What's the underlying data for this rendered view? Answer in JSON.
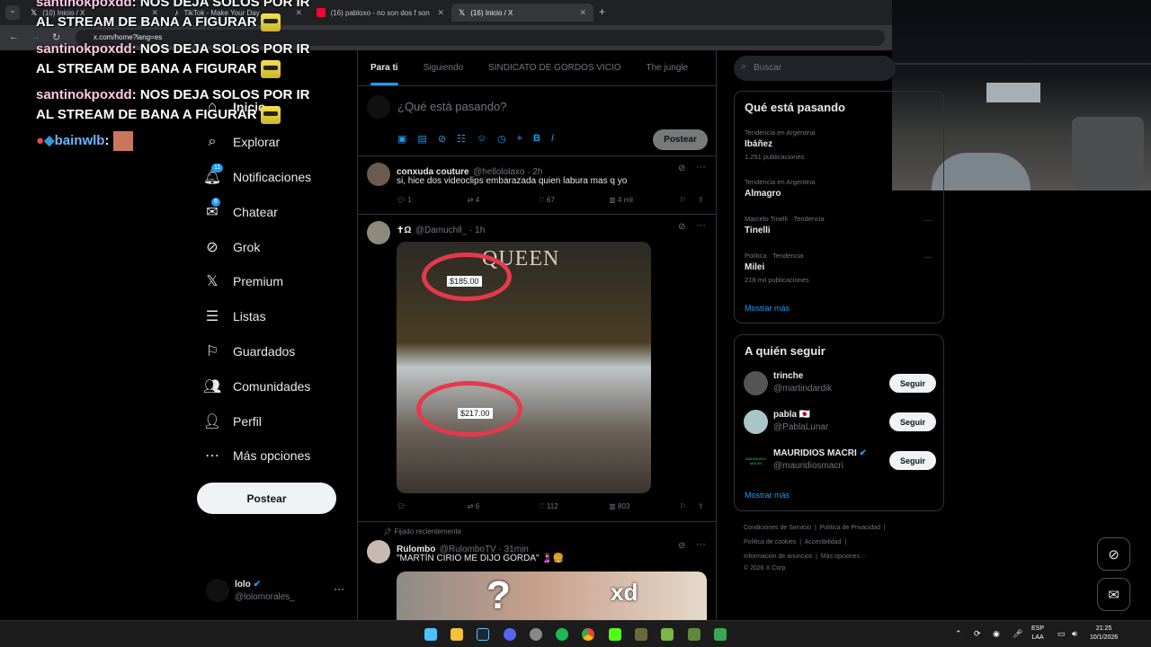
{
  "browser": {
    "tabs": [
      {
        "label": "(10) Inicio / X",
        "icon": "x-logo-icon"
      },
      {
        "label": "TikTok - Make Your Day",
        "icon": "tiktok-icon"
      },
      {
        "label": "(16) pabloxo - no son dos f son",
        "icon": "youtube-icon"
      },
      {
        "label": "(16) Inicio / X",
        "icon": "x-logo-icon"
      }
    ],
    "url": "x.com/home?lang=es"
  },
  "chat_overlay": [
    {
      "user": "santinokpoxdd",
      "message": "NOS DEJA SOLOS POR IR AL STREAM DE BANA A FIGURAR"
    },
    {
      "user": "santinokpoxdd",
      "message": "NOS DEJA SOLOS POR IR AL STREAM DE BANA A FIGURAR"
    },
    {
      "user": "santinokpoxdd",
      "message": "NOS DEJA SOLOS POR IR AL STREAM DE BANA A FIGURAR"
    },
    {
      "user": "bainwlb",
      "message": ""
    }
  ],
  "nav": {
    "items": [
      {
        "label": "Inicio",
        "icon": "home-icon"
      },
      {
        "label": "Explorar",
        "icon": "search-icon"
      },
      {
        "label": "Notificaciones",
        "icon": "bell-icon",
        "badge": "11"
      },
      {
        "label": "Chatear",
        "icon": "mail-icon",
        "badge": "6"
      },
      {
        "label": "Grok",
        "icon": "grok-icon"
      },
      {
        "label": "Premium",
        "icon": "x-logo-icon"
      },
      {
        "label": "Listas",
        "icon": "list-icon"
      },
      {
        "label": "Guardados",
        "icon": "bookmark-icon"
      },
      {
        "label": "Comunidades",
        "icon": "communities-icon"
      },
      {
        "label": "Perfil",
        "icon": "person-icon"
      },
      {
        "label": "Más opciones",
        "icon": "more-circle-icon"
      }
    ],
    "post_button": "Postear",
    "account": {
      "name": "lolo",
      "handle": "@lolomorales_"
    }
  },
  "feed": {
    "tabs": [
      "Para ti",
      "Siguiendo",
      "SINDICATO DE GORDOS VICIO",
      "The jungle"
    ],
    "compose_placeholder": "¿Qué está pasando?",
    "compose_button": "Postear",
    "tweets": [
      {
        "name": "conxuda couture",
        "handle": "@hellololaxo · 2h",
        "text": "si, hice dos videoclips embarazada quien labura mas q yo",
        "replies": "1",
        "reposts": "4",
        "likes": "67",
        "views": "4 mil"
      },
      {
        "name": "✝Ω",
        "handle": "@Damuchll_ · 1h",
        "text": "",
        "image_text": [
          "QUEEN",
          "$185.00",
          "$217.00"
        ],
        "replies": "",
        "reposts": "6",
        "likes": "112",
        "views": "803"
      },
      {
        "pinned_label": "Fijado recientemente",
        "name": "Rulombo",
        "handle": "@RulomboTV · 31min",
        "text": "\"MARTÍN CIRIO ME DIJO GORDA\" 🤰🍔",
        "image_text": [
          "?",
          "xd"
        ]
      }
    ]
  },
  "sidebar": {
    "search_placeholder": "Buscar",
    "trends_title": "Qué está pasando",
    "trends": [
      {
        "category": "Tendencia en Argentina",
        "title": "Ibáñez",
        "count": "1.291 publicaciones"
      },
      {
        "category": "Tendencia en Argentina",
        "title": "Almagro",
        "count": ""
      },
      {
        "category": "Marcelo Tinelli · Tendencia",
        "title": "Tinelli",
        "count": ""
      },
      {
        "category": "Política · Tendencia",
        "title": "Milei",
        "count": "218 mil publicaciones"
      }
    ],
    "trends_more": "Mostrar más",
    "follow_title": "A quién seguir",
    "follow": [
      {
        "name": "trinche",
        "handle": "@martindardik",
        "button": "Seguir"
      },
      {
        "name": "pabla 🇯🇵",
        "handle": "@PablaLunar",
        "button": "Seguir"
      },
      {
        "name": "MAURIDIOS MACRI",
        "handle": "@mauridiosmacri",
        "button": "Seguir",
        "avatar_text": "MAURIDIOS MACRI"
      }
    ],
    "follow_more": "Mostrar más",
    "footer": [
      "Condiciones de Servicio",
      "Política de Privacidad",
      "Política de cookies",
      "Accesibilidad",
      "Información de anuncios",
      "Más opciones ···",
      "© 2026 X Corp."
    ]
  },
  "taskbar": {
    "lang": "ESP",
    "lang2": "LAA",
    "time": "21:25",
    "date": "10/1/2026"
  },
  "colors": {
    "accent": "#1d9bf0",
    "bg": "#000000",
    "border": "#2f3336",
    "muted": "#71767b"
  }
}
